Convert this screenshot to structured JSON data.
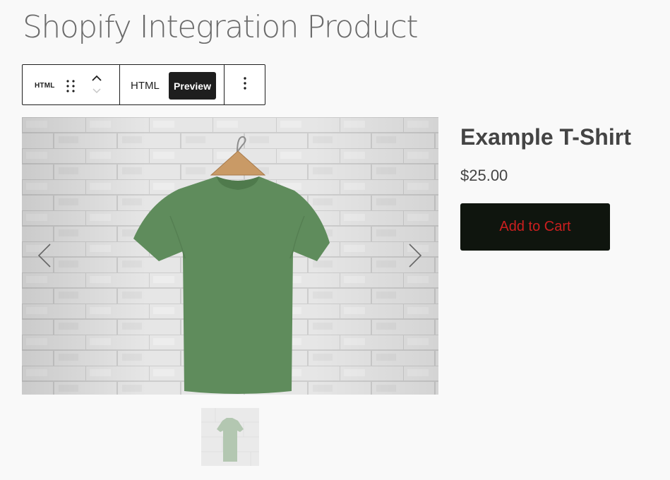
{
  "page": {
    "title": "Shopify Integration Product"
  },
  "toolbar": {
    "block_type_label": "HTML",
    "tabs": [
      {
        "label": "HTML",
        "active": false
      },
      {
        "label": "Preview",
        "active": true
      }
    ],
    "icons": {
      "drag": "drag-handle-icon",
      "move_up": "chevron-up-icon",
      "move_down": "chevron-down-icon",
      "more": "more-vertical-icon"
    }
  },
  "product": {
    "name": "Example T-Shirt",
    "price": "$25.00",
    "add_to_cart_label": "Add to Cart",
    "colors": {
      "button_bg": "#0f150e",
      "button_text": "#cc1f1f",
      "shirt": "#5f8c5c"
    }
  },
  "gallery": {
    "icons": {
      "prev": "chevron-left-icon",
      "next": "chevron-right-icon"
    },
    "thumbnail_count": 1
  }
}
